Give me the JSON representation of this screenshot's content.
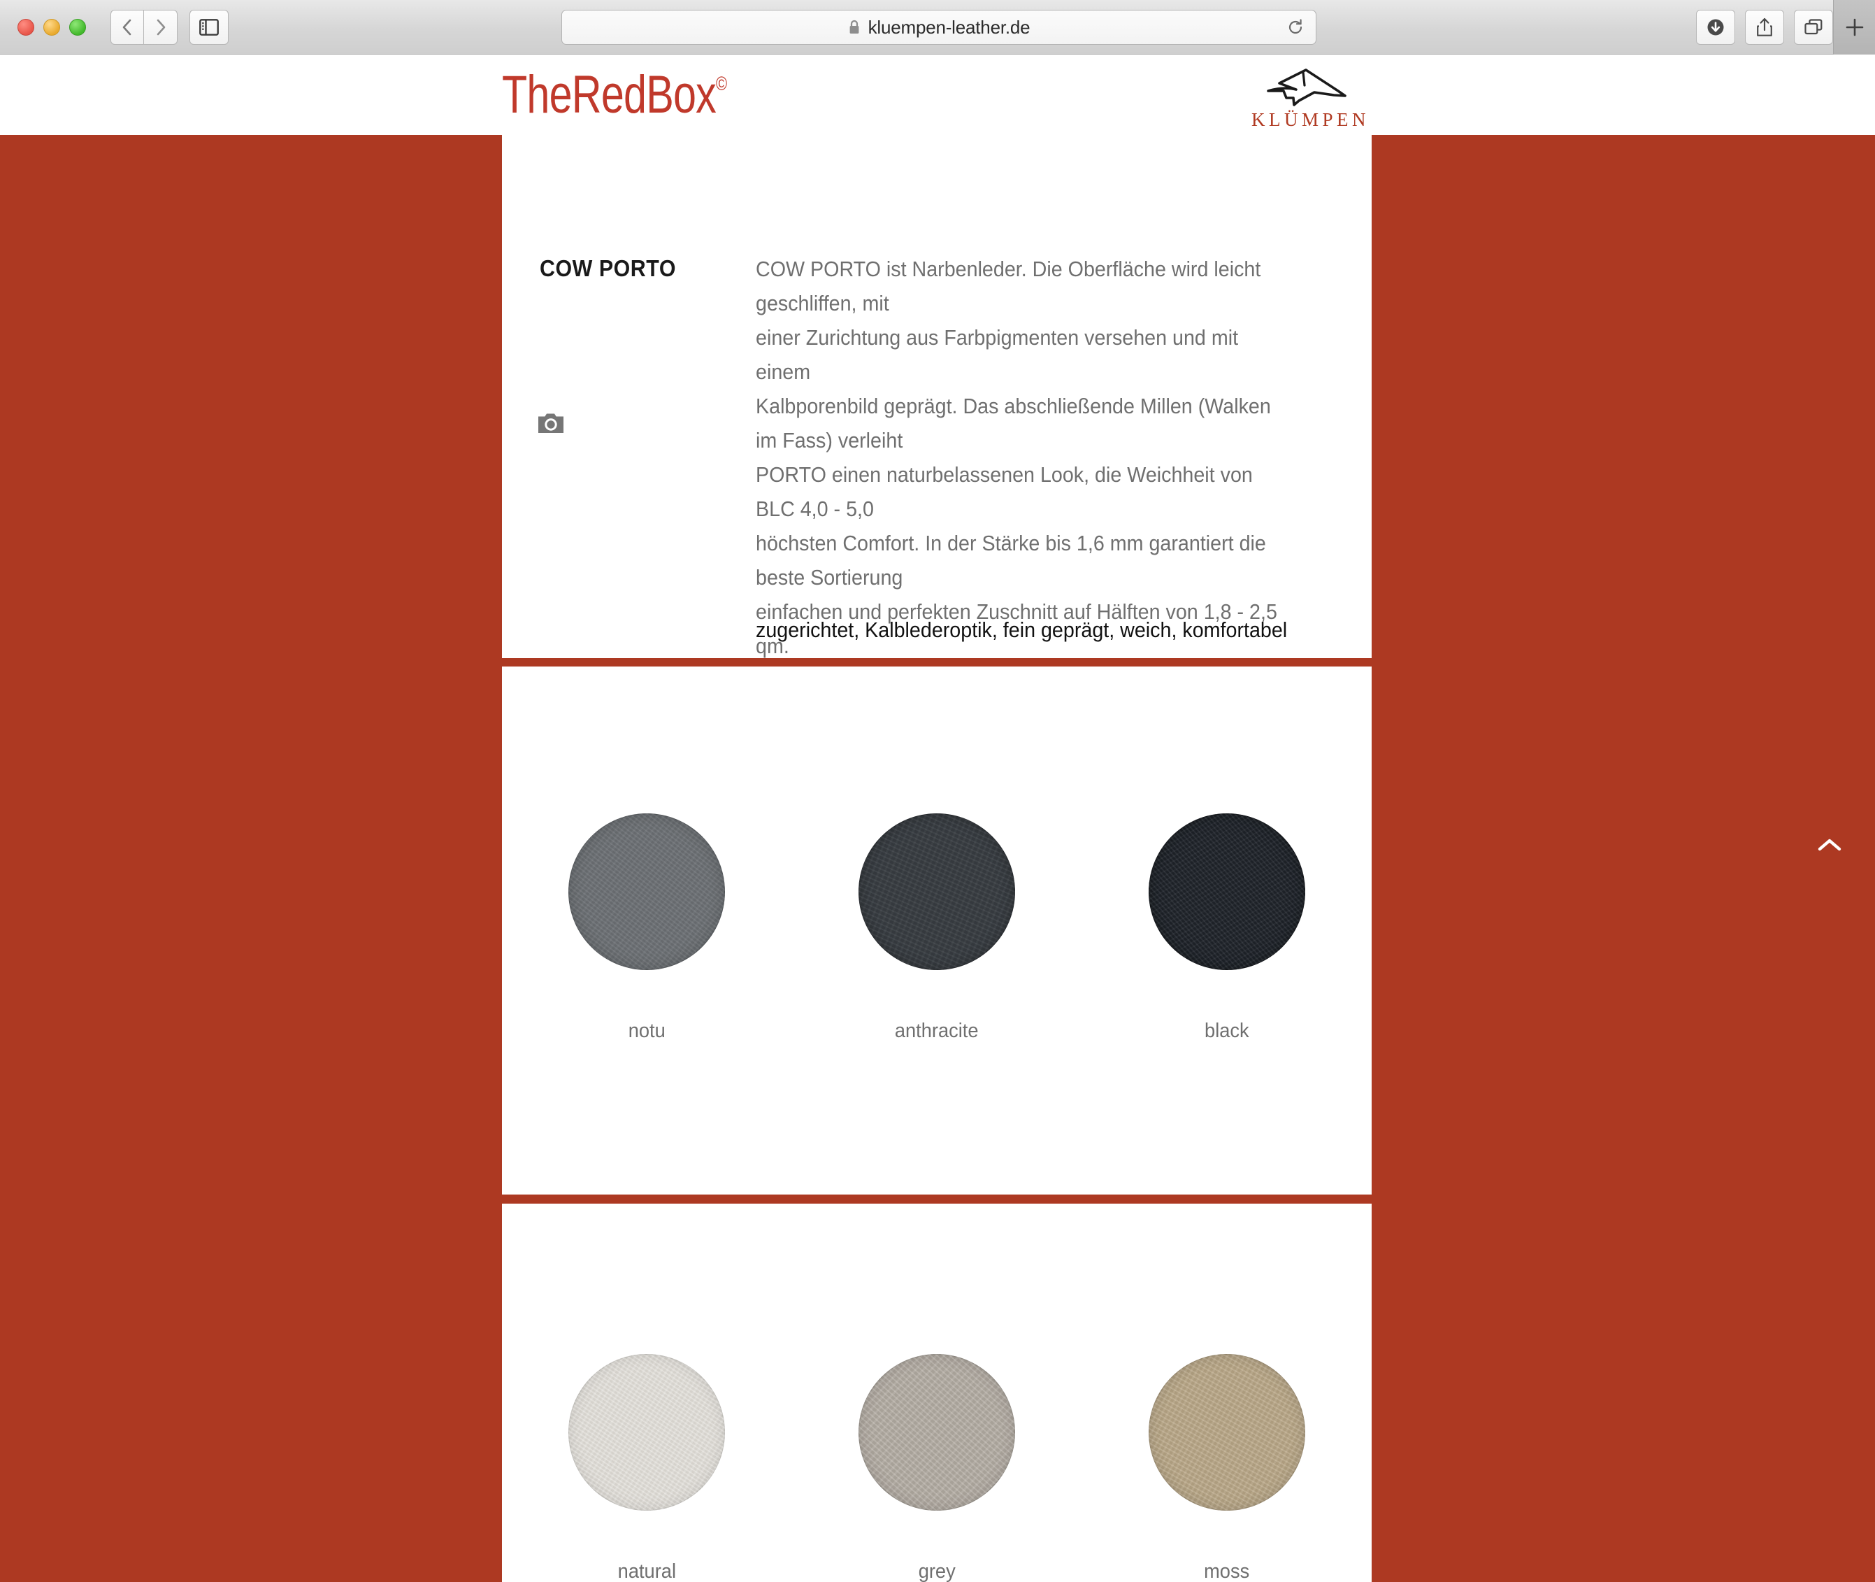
{
  "browser": {
    "url": "kluempen-leather.de",
    "lock_icon": "lock-icon",
    "back_icon": "chevron-left-icon",
    "forward_icon": "chevron-right-icon",
    "sidebar_icon": "sidebar-toggle-icon",
    "reload_icon": "reload-icon",
    "downloads_icon": "download-icon",
    "share_icon": "share-icon",
    "tabs_icon": "tab-overview-icon",
    "newtab_icon": "plus-icon",
    "traffic_lights": [
      "close-button",
      "minimize-button",
      "maximize-button"
    ]
  },
  "site": {
    "brand": "TheRedBox",
    "brand_mark": "©",
    "company": "KLÜMPEN",
    "company_logo_icon": "cow-head-logo-icon",
    "accent_color": "#ad3922",
    "brand_color": "#c0392b"
  },
  "product": {
    "title": "COW PORTO",
    "gallery_icon": "camera-icon",
    "description": [
      "COW PORTO ist Narbenleder. Die Oberfläche wird leicht geschliffen, mit",
      "einer Zurichtung aus Farbpigmenten versehen und mit einem",
      "Kalbporenbild geprägt. Das abschließende Millen (Walken im Fass) verleiht",
      "PORTO einen naturbelassenen Look, die Weichheit von BLC 4,0 - 5,0",
      "höchsten Comfort. In der Stärke bis 1,6 mm garantiert die beste Sortierung",
      "einfachen und perfekten Zuschnitt auf Hälften von 1,8 - 2,5 qm."
    ],
    "keywords": "zugerichtet, Kalblederoptik, fein geprägt, weich, komfortabel"
  },
  "swatch_rows": [
    {
      "items": [
        {
          "label": "notu",
          "color": "#6d7175",
          "edge": "#5d6165"
        },
        {
          "label": "anthracite",
          "color": "#3a3f44",
          "edge": "#2f3338"
        },
        {
          "label": "black",
          "color": "#22272e",
          "edge": "#1a1e24"
        }
      ]
    },
    {
      "items": [
        {
          "label": "natural",
          "color": "#dfdcd6",
          "edge": "#cdc9c2"
        },
        {
          "label": "grey",
          "color": "#b3aca3",
          "edge": "#a29b92"
        },
        {
          "label": "moss",
          "color": "#b9a787",
          "edge": "#a89576"
        }
      ]
    }
  ],
  "controls": {
    "scroll_top_icon": "chevron-up-icon"
  }
}
